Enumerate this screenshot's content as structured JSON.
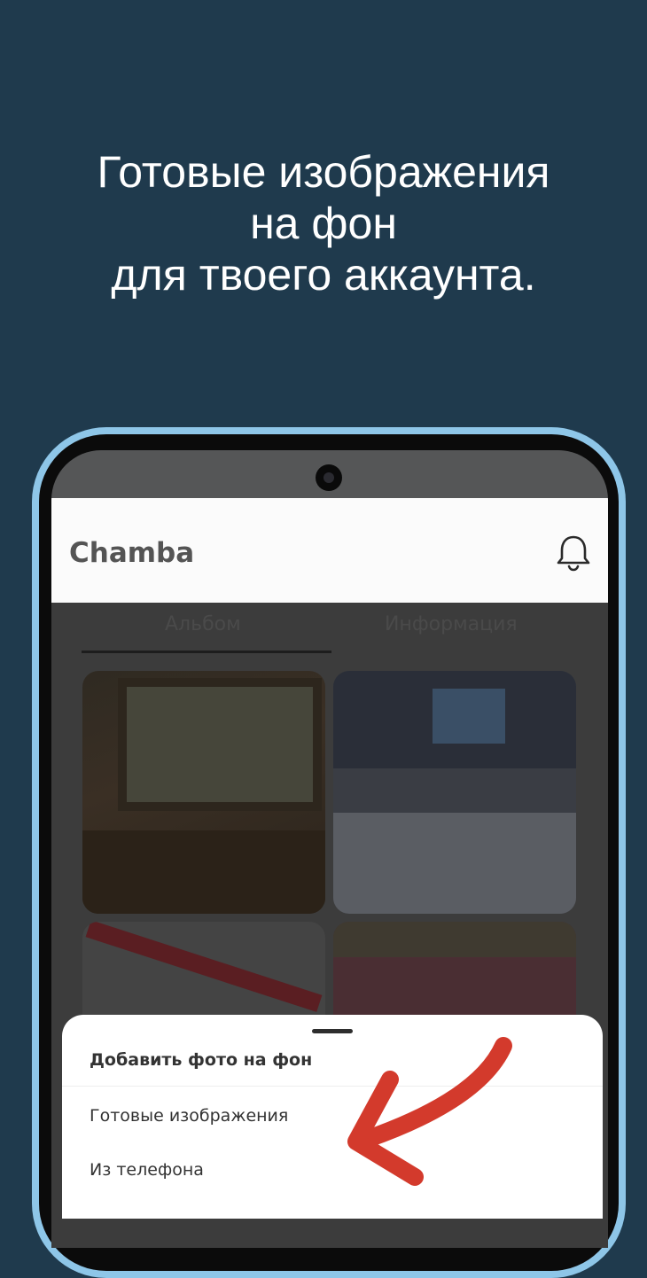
{
  "headline": {
    "line1": "Готовые изображения",
    "line2": "на фон",
    "line3": "для твоего аккаунта."
  },
  "app": {
    "title": "Chamba",
    "notification_icon": "bell-icon"
  },
  "tabs": [
    {
      "label": "Альбом",
      "selected": true
    },
    {
      "label": "Информация",
      "selected": false
    }
  ],
  "bottom_sheet": {
    "title": "Добавить фото на фон",
    "options": [
      {
        "label": "Готовые изображения"
      },
      {
        "label": "Из телефона"
      }
    ]
  },
  "colors": {
    "background": "#1f3a4d",
    "phone_frame": "#8ec6e8",
    "arrow": "#d33a2c"
  }
}
